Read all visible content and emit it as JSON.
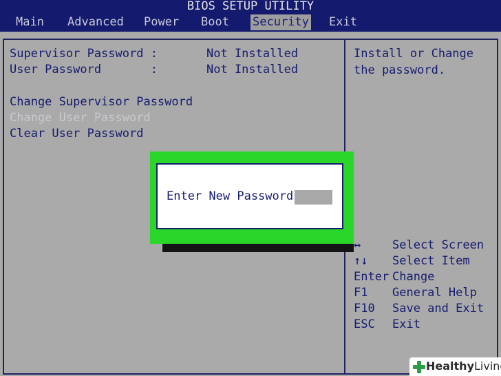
{
  "header": {
    "title": "BIOS SETUP UTILITY",
    "tabs": [
      {
        "label": "Main"
      },
      {
        "label": "Advanced"
      },
      {
        "label": "Power"
      },
      {
        "label": "Boot"
      },
      {
        "label": "Security",
        "active": true
      },
      {
        "label": "Exit"
      }
    ]
  },
  "security": {
    "supervisor_label": "Supervisor Password :",
    "supervisor_value": "Not Installed",
    "user_label": "User Password       :",
    "user_value": "Not Installed",
    "change_supervisor": "Change Supervisor Password",
    "change_user": "Change User Password",
    "clear_user": "Clear User Password"
  },
  "help": {
    "text": "Install or Change the password."
  },
  "keys": [
    {
      "key": "↔",
      "desc": "Select Screen"
    },
    {
      "key": "↑↓",
      "desc": "Select Item"
    },
    {
      "key": "Enter",
      "desc": "Change"
    },
    {
      "key": "F1",
      "desc": "General Help"
    },
    {
      "key": "F10",
      "desc": "Save and Exit"
    },
    {
      "key": "ESC",
      "desc": "Exit"
    }
  ],
  "dialog": {
    "label": "Enter New Password",
    "field_value": ""
  },
  "watermark": {
    "bold": "Healthy",
    "rest": "Living",
    "icon": "plus-leaf-icon"
  },
  "colors": {
    "header_bg": "#141a6e",
    "text": "#161c6e",
    "highlight_frame": "#2bd62b"
  }
}
